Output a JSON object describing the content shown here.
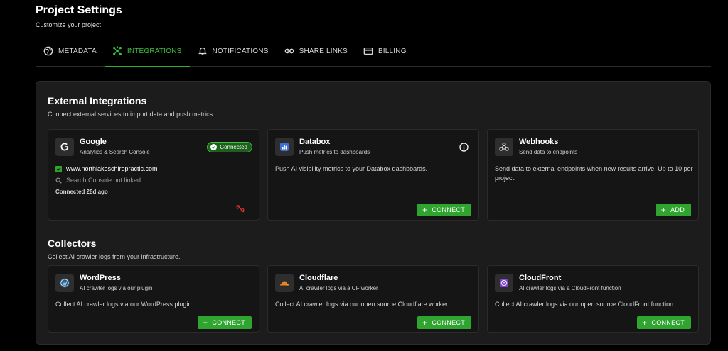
{
  "header": {
    "title": "Project Settings",
    "subtitle": "Customize your project"
  },
  "tabs": [
    {
      "label": "METADATA",
      "icon": "globe-icon",
      "active": false
    },
    {
      "label": "INTEGRATIONS",
      "icon": "hub-icon",
      "active": true
    },
    {
      "label": "NOTIFICATIONS",
      "icon": "bell-icon",
      "active": false
    },
    {
      "label": "SHARE LINKS",
      "icon": "link-icon",
      "active": false
    },
    {
      "label": "BILLING",
      "icon": "credit-card-icon",
      "active": false
    }
  ],
  "external": {
    "title": "External Integrations",
    "description": "Connect external services to import data and push metrics.",
    "google": {
      "title": "Google",
      "subtitle": "Analytics & Search Console",
      "badge": "Connected",
      "site": "www.northlakeschiropractic.com",
      "console_status": "Search Console not linked",
      "connected_time": "Connected 28d ago"
    },
    "databox": {
      "title": "Databox",
      "subtitle": "Push metrics to dashboards",
      "body": "Push AI visibility metrics to your Databox dashboards.",
      "button": "CONNECT"
    },
    "webhooks": {
      "title": "Webhooks",
      "subtitle": "Send data to endpoints",
      "body": "Send data to external endpoints when new results arrive. Up to 10 per project.",
      "button": "ADD"
    }
  },
  "collectors": {
    "title": "Collectors",
    "description": "Collect AI crawler logs from your infrastructure.",
    "wordpress": {
      "title": "WordPress",
      "subtitle": "AI crawler logs via our plugin",
      "body": "Collect AI crawler logs via our WordPress plugin.",
      "button": "CONNECT"
    },
    "cloudflare": {
      "title": "Cloudflare",
      "subtitle": "AI crawler logs via a CF worker",
      "body": "Collect AI crawler logs via our open source Cloudflare worker.",
      "button": "CONNECT"
    },
    "cloudfront": {
      "title": "CloudFront",
      "subtitle": "AI crawler logs via a CloudFront function",
      "body": "Collect AI crawler logs via our open source CloudFront function.",
      "button": "CONNECT"
    }
  },
  "colors": {
    "accent": "#2fa52f",
    "background": "#000000",
    "panel": "#1c1c1c",
    "card": "#151515"
  }
}
